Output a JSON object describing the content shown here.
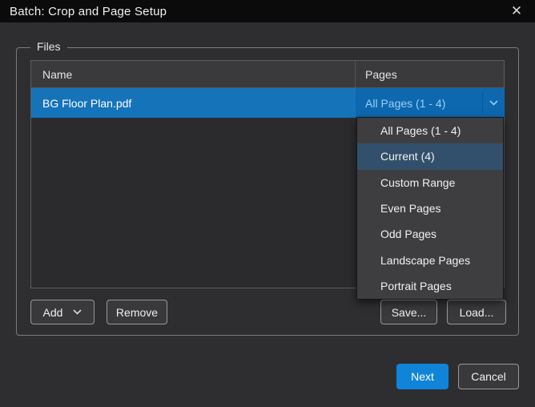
{
  "window": {
    "title": "Batch: Crop and Page Setup",
    "close_glyph": "✕"
  },
  "files_group": {
    "label": "Files",
    "table": {
      "columns": {
        "name": "Name",
        "pages": "Pages"
      },
      "rows": [
        {
          "name": "BG Floor Plan.pdf",
          "pages_value": "All Pages (1 - 4)",
          "selected": true
        }
      ]
    },
    "add_button": "Add",
    "remove_button": "Remove",
    "save_button": "Save...",
    "load_button": "Load..."
  },
  "pages_dropdown": {
    "items": [
      {
        "label": "All Pages (1 - 4)",
        "highlighted": false
      },
      {
        "label": "Current (4)",
        "highlighted": true
      },
      {
        "label": "Custom Range",
        "highlighted": false
      },
      {
        "label": "Even Pages",
        "highlighted": false
      },
      {
        "label": "Odd Pages",
        "highlighted": false
      },
      {
        "label": "Landscape Pages",
        "highlighted": false
      },
      {
        "label": "Portrait Pages",
        "highlighted": false
      }
    ]
  },
  "footer": {
    "next_button": "Next",
    "cancel_button": "Cancel"
  },
  "colors": {
    "titlebar_bg": "#0b0b0b",
    "dialog_bg": "#2e2e30",
    "selected_row": "#1573ba",
    "combobox_bg": "#0d68b0",
    "combobox_text": "#9bd0f3",
    "menu_bg": "#3e3e40",
    "menu_highlight": "#32506b",
    "primary_button": "#1084d8"
  }
}
